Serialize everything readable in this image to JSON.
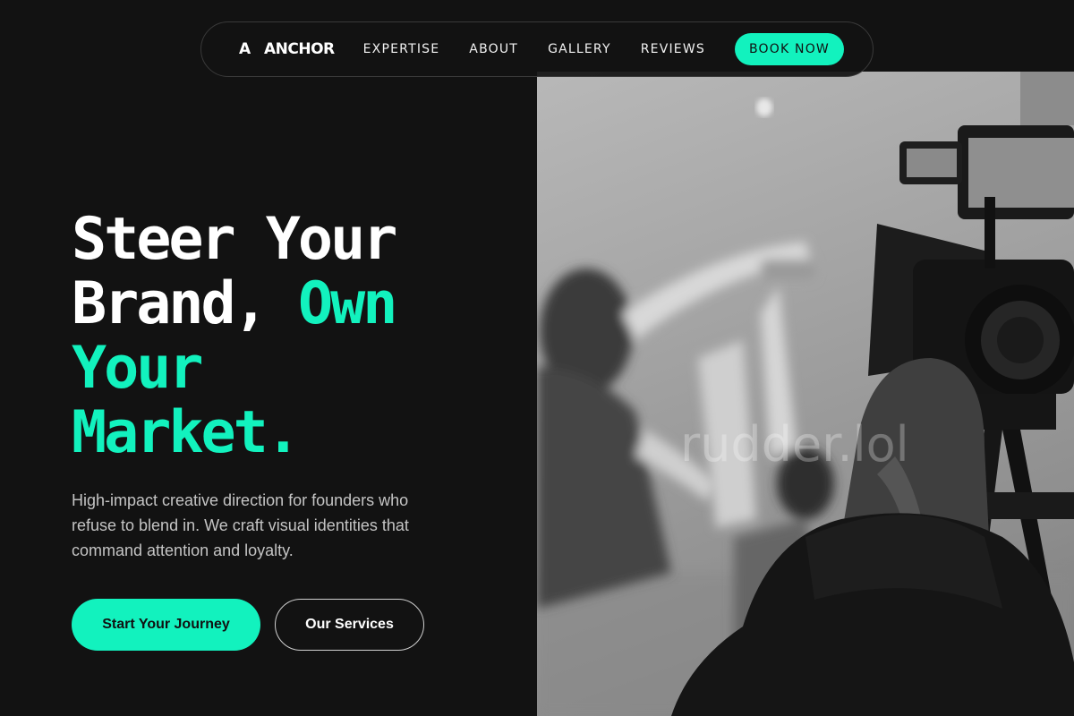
{
  "nav": {
    "logo_mark": "A",
    "logo_text": "ANCHOR",
    "links": [
      "EXPERTISE",
      "ABOUT",
      "GALLERY",
      "REVIEWS"
    ],
    "cta": "BOOK NOW"
  },
  "hero": {
    "title_line1": "Steer Your",
    "title_line2_plain": "Brand, ",
    "title_line2_accent": "Own",
    "title_line3_accent": "Your",
    "title_line4_accent": "Market.",
    "subtitle": "High-impact creative direction for founders who refuse to blend in. We craft visual identities that command attention and loyalty.",
    "primary_button": "Start Your Journey",
    "secondary_button": "Our Services"
  },
  "image": {
    "watermark": "rudder.lol",
    "icon": "film-production-photo"
  },
  "colors": {
    "accent": "#12f2be",
    "background": "#121212"
  }
}
